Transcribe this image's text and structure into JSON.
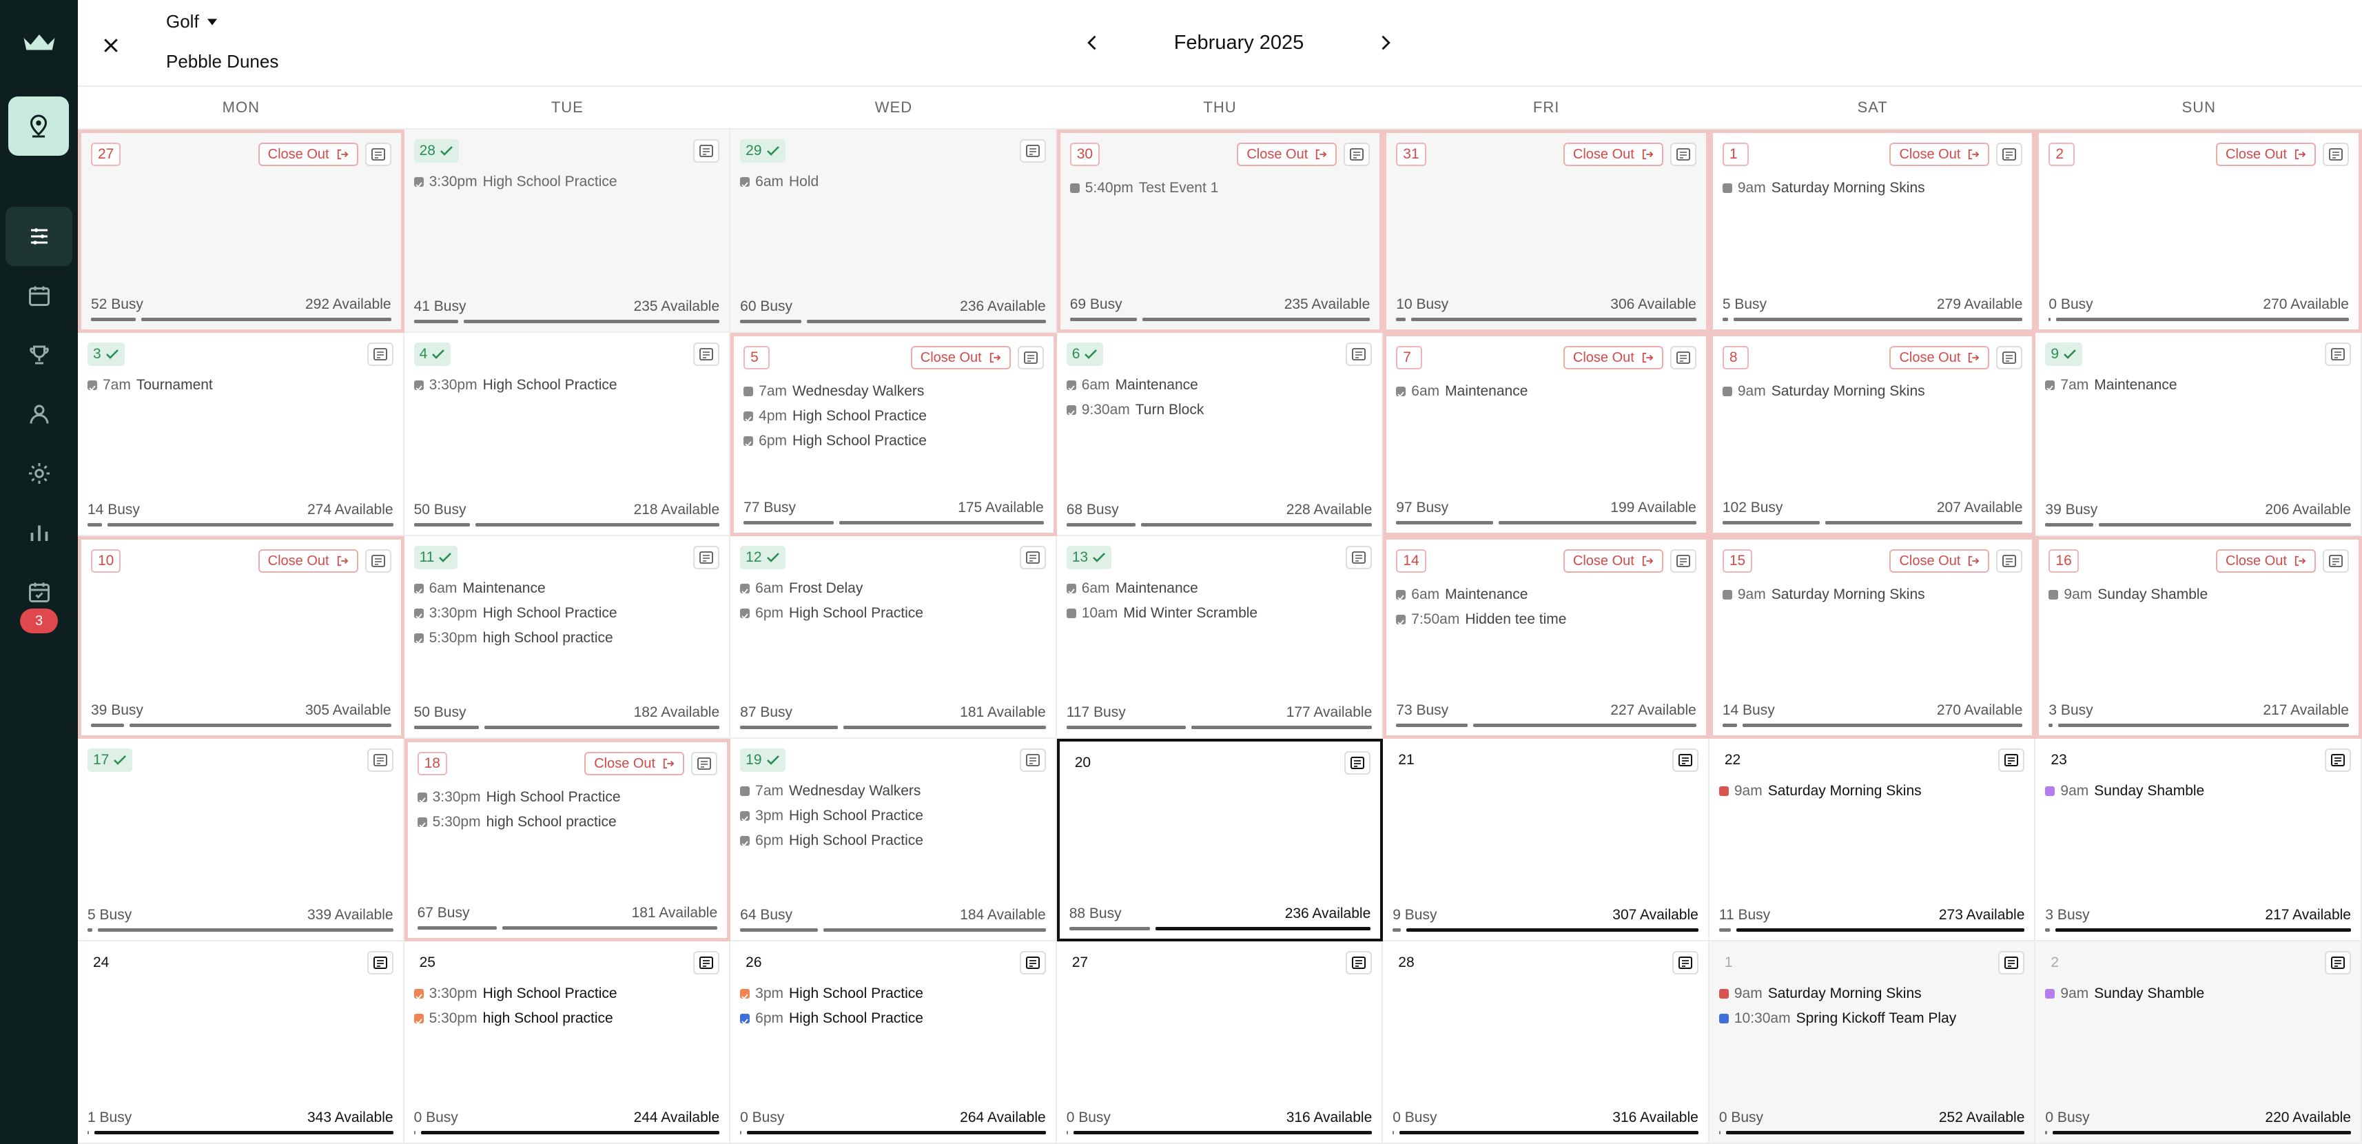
{
  "header": {
    "sport": "Golf",
    "course": "Pebble Dunes",
    "month": "February 2025"
  },
  "sidebar": {
    "badge_count": "3"
  },
  "weekdays": [
    "MON",
    "TUE",
    "WED",
    "THU",
    "FRI",
    "SAT",
    "SUN"
  ],
  "labels": {
    "close_out": "Close Out"
  },
  "colors": {
    "accent_green": "#2a8d55",
    "close_out_red": "#d24a4a",
    "event_red": "#d9534f",
    "event_purple": "#b57cf0",
    "event_orange": "#f0834f",
    "event_blue": "#3f6fd8",
    "event_gray": "#8a8a8a"
  },
  "weeks": [
    [
      {
        "day": "27",
        "state": "red",
        "past": true,
        "closeout": true,
        "events": [],
        "busy": "52 Busy",
        "available": "292 Available",
        "busy_frac": 0.151
      },
      {
        "day": "28",
        "state": "green",
        "past": true,
        "closeout": false,
        "events": [
          {
            "time": "3:30pm",
            "title": "High School Practice",
            "color": "#8a8a8a",
            "icon": "check"
          }
        ],
        "busy": "41 Busy",
        "available": "235 Available",
        "busy_frac": 0.149
      },
      {
        "day": "29",
        "state": "green",
        "past": true,
        "closeout": false,
        "events": [
          {
            "time": "6am",
            "title": "Hold",
            "color": "#8a8a8a",
            "icon": "check"
          }
        ],
        "busy": "60 Busy",
        "available": "236 Available",
        "busy_frac": 0.203
      },
      {
        "day": "30",
        "state": "red",
        "past": true,
        "closeout": true,
        "events": [
          {
            "time": "5:40pm",
            "title": "Test Event 1",
            "color": "#8a8a8a",
            "icon": "square"
          }
        ],
        "busy": "69 Busy",
        "available": "235 Available",
        "busy_frac": 0.227
      },
      {
        "day": "31",
        "state": "red",
        "past": true,
        "closeout": true,
        "events": [],
        "busy": "10 Busy",
        "available": "306 Available",
        "busy_frac": 0.032
      },
      {
        "day": "1",
        "state": "red",
        "past": false,
        "closeout": true,
        "events": [
          {
            "time": "9am",
            "title": "Saturday Morning Skins",
            "color": "#8a8a8a",
            "icon": "square"
          }
        ],
        "busy": "5 Busy",
        "available": "279 Available",
        "busy_frac": 0.018
      },
      {
        "day": "2",
        "state": "red",
        "past": false,
        "closeout": true,
        "events": [],
        "busy": "0 Busy",
        "available": "270 Available",
        "busy_frac": 0.0
      }
    ],
    [
      {
        "day": "3",
        "state": "green",
        "past": false,
        "closeout": false,
        "events": [
          {
            "time": "7am",
            "title": "Tournament",
            "color": "#8a8a8a",
            "icon": "check"
          }
        ],
        "busy": "14 Busy",
        "available": "274 Available",
        "busy_frac": 0.049
      },
      {
        "day": "4",
        "state": "green",
        "past": false,
        "closeout": false,
        "events": [
          {
            "time": "3:30pm",
            "title": "High School Practice",
            "color": "#8a8a8a",
            "icon": "check"
          }
        ],
        "busy": "50 Busy",
        "available": "218 Available",
        "busy_frac": 0.187
      },
      {
        "day": "5",
        "state": "red",
        "past": false,
        "closeout": true,
        "events": [
          {
            "time": "7am",
            "title": "Wednesday Walkers",
            "color": "#8a8a8a",
            "icon": "square"
          },
          {
            "time": "4pm",
            "title": "High School Practice",
            "color": "#8a8a8a",
            "icon": "check"
          },
          {
            "time": "6pm",
            "title": "High School Practice",
            "color": "#8a8a8a",
            "icon": "check"
          }
        ],
        "busy": "77 Busy",
        "available": "175 Available",
        "busy_frac": 0.306
      },
      {
        "day": "6",
        "state": "green",
        "past": false,
        "closeout": false,
        "events": [
          {
            "time": "6am",
            "title": "Maintenance",
            "color": "#8a8a8a",
            "icon": "check"
          },
          {
            "time": "9:30am",
            "title": "Turn Block",
            "color": "#8a8a8a",
            "icon": "check"
          }
        ],
        "busy": "68 Busy",
        "available": "228 Available",
        "busy_frac": 0.23
      },
      {
        "day": "7",
        "state": "red",
        "past": false,
        "closeout": true,
        "events": [
          {
            "time": "6am",
            "title": "Maintenance",
            "color": "#8a8a8a",
            "icon": "check"
          }
        ],
        "busy": "97 Busy",
        "available": "199 Available",
        "busy_frac": 0.328
      },
      {
        "day": "8",
        "state": "red",
        "past": false,
        "closeout": true,
        "events": [
          {
            "time": "9am",
            "title": "Saturday Morning Skins",
            "color": "#8a8a8a",
            "icon": "square"
          }
        ],
        "busy": "102 Busy",
        "available": "207 Available",
        "busy_frac": 0.33
      },
      {
        "day": "9",
        "state": "green",
        "past": false,
        "closeout": false,
        "events": [
          {
            "time": "7am",
            "title": "Maintenance",
            "color": "#8a8a8a",
            "icon": "check"
          }
        ],
        "busy": "39 Busy",
        "available": "206 Available",
        "busy_frac": 0.159
      }
    ],
    [
      {
        "day": "10",
        "state": "red",
        "past": false,
        "closeout": true,
        "events": [],
        "busy": "39 Busy",
        "available": "305 Available",
        "busy_frac": 0.113
      },
      {
        "day": "11",
        "state": "green",
        "past": false,
        "closeout": false,
        "events": [
          {
            "time": "6am",
            "title": "Maintenance",
            "color": "#8a8a8a",
            "icon": "check"
          },
          {
            "time": "3:30pm",
            "title": "High School Practice",
            "color": "#8a8a8a",
            "icon": "check"
          },
          {
            "time": "5:30pm",
            "title": "high School practice",
            "color": "#8a8a8a",
            "icon": "check"
          }
        ],
        "busy": "50 Busy",
        "available": "182 Available",
        "busy_frac": 0.216
      },
      {
        "day": "12",
        "state": "green",
        "past": false,
        "closeout": false,
        "events": [
          {
            "time": "6am",
            "title": "Frost Delay",
            "color": "#8a8a8a",
            "icon": "check"
          },
          {
            "time": "6pm",
            "title": "High School Practice",
            "color": "#8a8a8a",
            "icon": "check"
          }
        ],
        "busy": "87 Busy",
        "available": "181 Available",
        "busy_frac": 0.325
      },
      {
        "day": "13",
        "state": "green",
        "past": false,
        "closeout": false,
        "events": [
          {
            "time": "6am",
            "title": "Maintenance",
            "color": "#8a8a8a",
            "icon": "check"
          },
          {
            "time": "10am",
            "title": "Mid Winter Scramble",
            "color": "#8a8a8a",
            "icon": "square"
          }
        ],
        "busy": "117 Busy",
        "available": "177 Available",
        "busy_frac": 0.398
      },
      {
        "day": "14",
        "state": "red",
        "past": false,
        "closeout": true,
        "events": [
          {
            "time": "6am",
            "title": "Maintenance",
            "color": "#8a8a8a",
            "icon": "check"
          },
          {
            "time": "7:50am",
            "title": "Hidden tee time",
            "color": "#8a8a8a",
            "icon": "check"
          }
        ],
        "busy": "73 Busy",
        "available": "227 Available",
        "busy_frac": 0.243
      },
      {
        "day": "15",
        "state": "red",
        "past": false,
        "closeout": true,
        "events": [
          {
            "time": "9am",
            "title": "Saturday Morning Skins",
            "color": "#8a8a8a",
            "icon": "square"
          }
        ],
        "busy": "14 Busy",
        "available": "270 Available",
        "busy_frac": 0.049
      },
      {
        "day": "16",
        "state": "red",
        "past": false,
        "closeout": true,
        "events": [
          {
            "time": "9am",
            "title": "Sunday Shamble",
            "color": "#8a8a8a",
            "icon": "square"
          }
        ],
        "busy": "3 Busy",
        "available": "217 Available",
        "busy_frac": 0.014
      }
    ],
    [
      {
        "day": "17",
        "state": "green",
        "past": false,
        "closeout": false,
        "events": [],
        "busy": "5 Busy",
        "available": "339 Available",
        "busy_frac": 0.015
      },
      {
        "day": "18",
        "state": "red",
        "past": false,
        "closeout": true,
        "events": [
          {
            "time": "3:30pm",
            "title": "High School Practice",
            "color": "#8a8a8a",
            "icon": "check"
          },
          {
            "time": "5:30pm",
            "title": "high School practice",
            "color": "#8a8a8a",
            "icon": "check"
          }
        ],
        "busy": "67 Busy",
        "available": "181 Available",
        "busy_frac": 0.27
      },
      {
        "day": "19",
        "state": "green",
        "past": false,
        "closeout": false,
        "events": [
          {
            "time": "7am",
            "title": "Wednesday Walkers",
            "color": "#8a8a8a",
            "icon": "square"
          },
          {
            "time": "3pm",
            "title": "High School Practice",
            "color": "#8a8a8a",
            "icon": "check"
          },
          {
            "time": "6pm",
            "title": "High School Practice",
            "color": "#8a8a8a",
            "icon": "check"
          }
        ],
        "busy": "64 Busy",
        "available": "184 Available",
        "busy_frac": 0.258
      },
      {
        "day": "20",
        "state": "today",
        "past": false,
        "closeout": false,
        "future": true,
        "events": [],
        "busy": "88 Busy",
        "available": "236 Available",
        "busy_frac": 0.272
      },
      {
        "day": "21",
        "state": "plain",
        "past": false,
        "closeout": false,
        "future": true,
        "events": [],
        "busy": "9 Busy",
        "available": "307 Available",
        "busy_frac": 0.028
      },
      {
        "day": "22",
        "state": "plain",
        "past": false,
        "closeout": false,
        "future": true,
        "events": [
          {
            "time": "9am",
            "title": "Saturday Morning Skins",
            "color": "#d9534f",
            "icon": "square"
          }
        ],
        "busy": "11 Busy",
        "available": "273 Available",
        "busy_frac": 0.039
      },
      {
        "day": "23",
        "state": "plain",
        "past": false,
        "closeout": false,
        "future": true,
        "events": [
          {
            "time": "9am",
            "title": "Sunday Shamble",
            "color": "#b57cf0",
            "icon": "square"
          }
        ],
        "busy": "3 Busy",
        "available": "217 Available",
        "busy_frac": 0.014
      }
    ],
    [
      {
        "day": "24",
        "state": "plain",
        "past": false,
        "closeout": false,
        "future": true,
        "events": [],
        "busy": "1 Busy",
        "available": "343 Available",
        "busy_frac": 0.003
      },
      {
        "day": "25",
        "state": "plain",
        "past": false,
        "closeout": false,
        "future": true,
        "events": [
          {
            "time": "3:30pm",
            "title": "High School Practice",
            "color": "#f0834f",
            "icon": "check"
          },
          {
            "time": "5:30pm",
            "title": "high School practice",
            "color": "#f0834f",
            "icon": "check"
          }
        ],
        "busy": "0 Busy",
        "available": "244 Available",
        "busy_frac": 0.0
      },
      {
        "day": "26",
        "state": "plain",
        "past": false,
        "closeout": false,
        "future": true,
        "events": [
          {
            "time": "3pm",
            "title": "High School Practice",
            "color": "#f0834f",
            "icon": "check"
          },
          {
            "time": "6pm",
            "title": "High School Practice",
            "color": "#3f6fd8",
            "icon": "check"
          }
        ],
        "busy": "0 Busy",
        "available": "264 Available",
        "busy_frac": 0.0
      },
      {
        "day": "27",
        "state": "plain",
        "past": false,
        "closeout": false,
        "future": true,
        "events": [],
        "busy": "0 Busy",
        "available": "316 Available",
        "busy_frac": 0.0
      },
      {
        "day": "28",
        "state": "plain",
        "past": false,
        "closeout": false,
        "future": true,
        "events": [],
        "busy": "0 Busy",
        "available": "316 Available",
        "busy_frac": 0.0
      },
      {
        "day": "1",
        "state": "gray",
        "past": true,
        "closeout": false,
        "future": true,
        "events": [
          {
            "time": "9am",
            "title": "Saturday Morning Skins",
            "color": "#d9534f",
            "icon": "square"
          },
          {
            "time": "10:30am",
            "title": "Spring Kickoff Team Play",
            "color": "#3f6fd8",
            "icon": "square"
          }
        ],
        "busy": "0 Busy",
        "available": "252 Available",
        "busy_frac": 0.0
      },
      {
        "day": "2",
        "state": "gray",
        "past": true,
        "closeout": false,
        "future": true,
        "events": [
          {
            "time": "9am",
            "title": "Sunday Shamble",
            "color": "#b57cf0",
            "icon": "square"
          }
        ],
        "busy": "0 Busy",
        "available": "220 Available",
        "busy_frac": 0.0
      }
    ]
  ]
}
